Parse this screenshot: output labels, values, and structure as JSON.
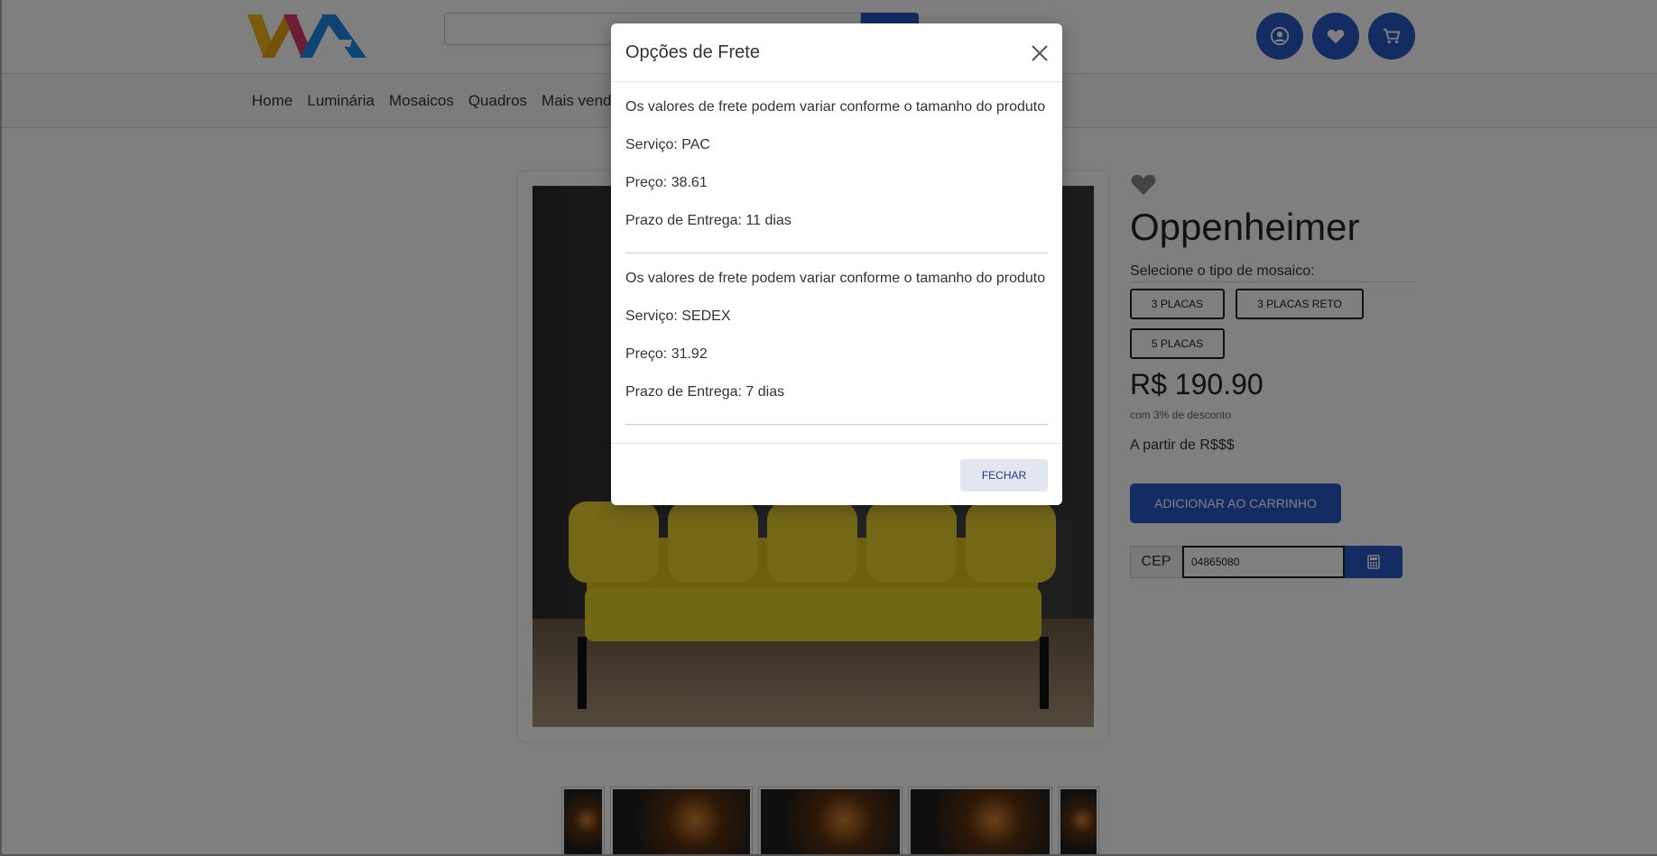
{
  "header": {
    "logo_text": "VVA",
    "search": {
      "placeholder": ""
    }
  },
  "nav": {
    "items": [
      "Home",
      "Luminária",
      "Mosaicos",
      "Quadros",
      "Mais vendido"
    ]
  },
  "product": {
    "title": "Oppenheimer",
    "select_label": "Selecione o tipo de mosaico:",
    "options": [
      "3 PLACAS",
      "3 PLACAS RETO",
      "5 PLACAS"
    ],
    "price": "R$ 190.90",
    "discount": "com 3% de desconto",
    "from_price": "A partir de R$$$",
    "add_to_cart": "ADICIONAR AO CARRINHO",
    "cep_label": "CEP",
    "cep_value": "04865080"
  },
  "modal": {
    "title": "Opções de Frete",
    "options": [
      {
        "note": "Os valores de frete podem variar conforme o tamanho do produto",
        "service": "Serviço: PAC",
        "price": "Preço: 38.61",
        "deadline": "Prazo de Entrega: 11 dias"
      },
      {
        "note": "Os valores de frete podem variar conforme o tamanho do produto",
        "service": "Serviço: SEDEX",
        "price": "Preço: 31.92",
        "deadline": "Prazo de Entrega: 7 dias"
      }
    ],
    "close_label": "FECHAR"
  },
  "icons": {
    "user": "user-circle-icon",
    "heart": "heart-icon",
    "cart": "cart-icon",
    "search": "search-icon",
    "calculator": "calculator-icon",
    "close": "close-icon"
  },
  "colors": {
    "primary": "#2b58c4",
    "overlay": "#000000"
  }
}
